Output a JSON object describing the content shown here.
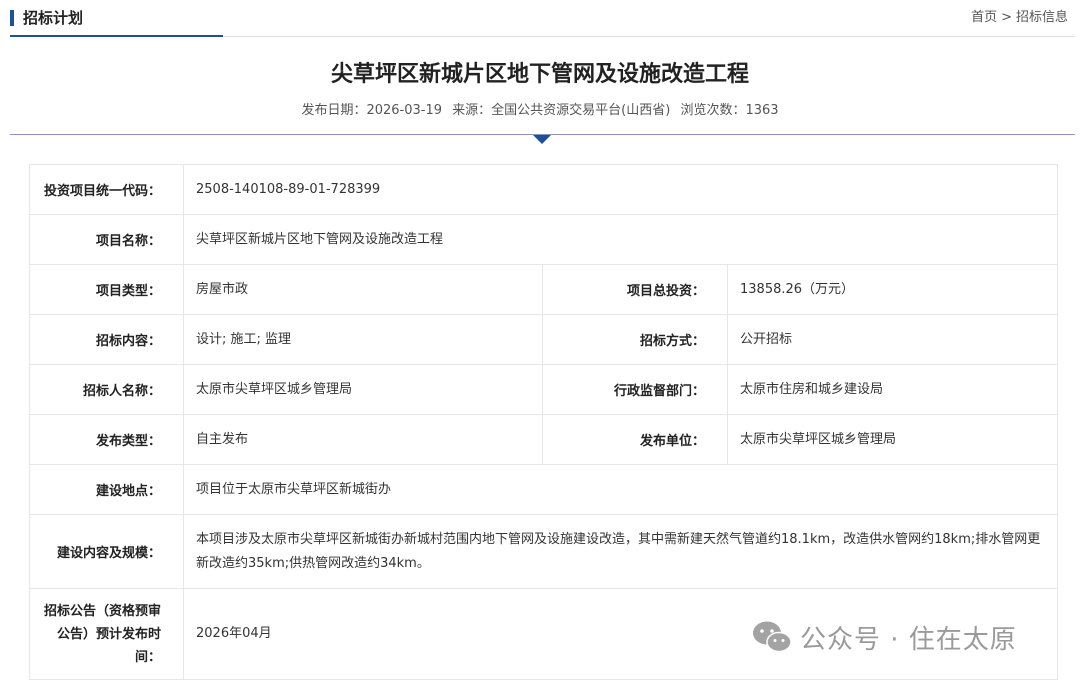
{
  "header": {
    "section_title": "招标计划",
    "breadcrumb": {
      "home": "首页",
      "separator": ">",
      "current": "招标信息"
    }
  },
  "article": {
    "title": "尖草坪区新城片区地下管网及设施改造工程",
    "meta": {
      "publish_date": "发布日期：2026-03-19",
      "source": "来源：全国公共资源交易平台(山西省)",
      "views": "浏览次数：1363"
    }
  },
  "info_table": {
    "code_label": "投资项目统一代码：",
    "code_value": "2508-140108-89-01-728399",
    "name_label": "项目名称：",
    "name_value": "尖草坪区新城片区地下管网及设施改造工程",
    "type_label": "项目类型：",
    "type_value": "房屋市政",
    "investment_label": "项目总投资：",
    "investment_value": "13858.26（万元）",
    "content_label": "招标内容：",
    "content_value": "设计; 施工; 监理",
    "method_label": "招标方式：",
    "method_value": "公开招标",
    "tenderer_label": "招标人名称：",
    "tenderer_value": "太原市尖草坪区城乡管理局",
    "supervisor_label": "行政监督部门：",
    "supervisor_value": "太原市住房和城乡建设局",
    "publish_type_label": "发布类型：",
    "publish_type_value": "自主发布",
    "publisher_label": "发布单位：",
    "publisher_value": "太原市尖草坪区城乡管理局",
    "location_label": "建设地点：",
    "location_value": "项目位于太原市尖草坪区新城街办",
    "scope_label": "建设内容及规模：",
    "scope_value": "本项目涉及太原市尖草坪区新城街办新城村范围内地下管网及设施建设改造，其中需新建天然气管道约18.1km，改造供水管网约18km;排水管网更新改造约35km;供热管网改造约34km。",
    "notice_label_line1": "招标公告（资格预审",
    "notice_label_line2": "公告）预计发布时",
    "notice_label_line3": "间：",
    "notice_value": "2026年04月"
  },
  "watermark": {
    "text": "公众号 · 住在太原",
    "icon": "wechat-icon"
  },
  "colors": {
    "accent": "#1f4e9a",
    "border": "#e6e6e6",
    "watermark": "#9a9a9a"
  }
}
